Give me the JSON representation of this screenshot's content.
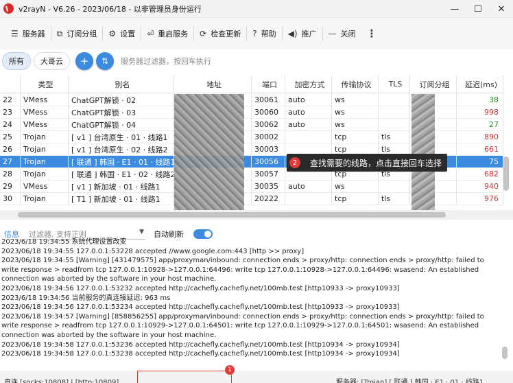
{
  "window": {
    "title": "v2rayN - V6.26 - 2023/06/18 - 以非管理员身份运行",
    "min": "—",
    "max": "☐",
    "close": "✕"
  },
  "menu": [
    {
      "icon": "☰",
      "label": "服务器"
    },
    {
      "icon": "⧉",
      "label": "订阅分组"
    },
    {
      "icon": "⚙",
      "label": "设置"
    },
    {
      "icon": "⏎",
      "label": "重启服务"
    },
    {
      "icon": "⟳",
      "label": "检查更新"
    },
    {
      "icon": "?",
      "label": "帮助"
    },
    {
      "icon": "◀)",
      "label": "推广"
    },
    {
      "icon": "—",
      "label": "关闭"
    },
    {
      "icon": "⋮",
      "label": ""
    }
  ],
  "filters": {
    "chips": [
      "所有",
      "大哥云"
    ],
    "add": "+",
    "sort": "⇅",
    "placeholder": "服务器过滤器，按回车执行"
  },
  "grid": {
    "headers": [
      "",
      "类型",
      "别名",
      "地址",
      "端口",
      "加密方式",
      "传输协议",
      "TLS",
      "订阅分组",
      "延迟(ms)"
    ],
    "rows": [
      {
        "id": "22",
        "type": "VMess",
        "alias": "ChatGPT解锁 · 02",
        "port": "30061",
        "enc": "auto",
        "net": "ws",
        "tls": "",
        "delay": "38",
        "color": "green"
      },
      {
        "id": "23",
        "type": "VMess",
        "alias": "ChatGPT解锁 · 03",
        "port": "30060",
        "enc": "auto",
        "net": "ws",
        "tls": "",
        "delay": "998",
        "color": "red"
      },
      {
        "id": "24",
        "type": "VMess",
        "alias": "ChatGPT解锁 · 04",
        "port": "30062",
        "enc": "auto",
        "net": "ws",
        "tls": "",
        "delay": "27",
        "color": "green"
      },
      {
        "id": "25",
        "type": "Trojan",
        "alias": "[ v1 ] 台湾原生 · 01 · 线路1",
        "port": "30002",
        "enc": "",
        "net": "tcp",
        "tls": "tls",
        "delay": "890",
        "color": "red"
      },
      {
        "id": "26",
        "type": "Trojan",
        "alias": "[ v1 ] 台湾原生 · 02 · 线路2",
        "port": "30003",
        "enc": "",
        "net": "tcp",
        "tls": "tls",
        "delay": "661",
        "color": "red"
      },
      {
        "id": "27",
        "type": "Trojan",
        "alias": "[ 联通 ] 韩国 · E1 · 01 · 线路1",
        "port": "30056",
        "enc": "",
        "net": "tcp",
        "tls": "tls",
        "delay": "75",
        "color": "green"
      },
      {
        "id": "28",
        "type": "Trojan",
        "alias": "[ 联通 ] 韩国 · E1 · 02 · 线路2",
        "port": "30057",
        "enc": "",
        "net": "tcp",
        "tls": "tls",
        "delay": "682",
        "color": "red"
      },
      {
        "id": "29",
        "type": "VMess",
        "alias": "[ v1 ] 新加坡 · 01 · 线路1",
        "port": "30035",
        "enc": "auto",
        "net": "ws",
        "tls": "",
        "delay": "940",
        "color": "red"
      },
      {
        "id": "30",
        "type": "Trojan",
        "alias": "[ T1 ] 新加坡 · 01 · 线路1",
        "port": "20222",
        "enc": "",
        "net": "tcp",
        "tls": "tls",
        "delay": "976",
        "color": "red"
      }
    ]
  },
  "tooltip": {
    "badge": "2",
    "text": "查找需要的线路，点击直接回车选择"
  },
  "logbar": {
    "tab": "信息",
    "filter_placeholder": "过滤器, 支持正则",
    "auto_label": "自动刷新"
  },
  "log": [
    "2023/6/18 19:34:55 系统代理设置改变",
    "2023/06/18 19:34:55 127.0.0.1:53228 accepted //www.google.com:443 [http >> proxy]",
    "2023/06/18 19:34:55 [Warning] [431479575] app/proxyman/inbound: connection ends > proxy/http: connection ends > proxy/http: failed to write response > readfrom tcp 127.0.0.1:10928->127.0.0.1:64496: write tcp 127.0.0.1:10928->127.0.0.1:64496: wsasend: An established connection was aborted by the software in your host machine.",
    "2023/06/18 19:34:56 127.0.0.1:53232 accepted http://cachefly.cachefly.net/100mb.test [http10933 -> proxy10933]",
    "2023/6/18 19:34:56 当前服务的真连接延迟: 963 ms",
    "2023/06/18 19:34:56 127.0.0.1:53234 accepted http://cachefly.cachefly.net/100mb.test [http10933 -> proxy10933]",
    "2023/06/18 19:34:57 [Warning] [858856255] app/proxyman/inbound: connection ends > proxy/http: connection ends > proxy/http: failed to write response > readfrom tcp 127.0.0.1:10929->127.0.0.1:64501: write tcp 127.0.0.1:10929->127.0.0.1:64501: wsasend: An established connection was aborted by the software in your host machine.",
    "2023/06/18 19:34:58 127.0.0.1:53236 accepted http://cachefly.cachefly.net/100mb.test [http10934 -> proxy10934]",
    "2023/06/18 19:34:58 127.0.0.1:53238 accepted http://cachefly.cachefly.net/100mb.test [http10934 -> proxy10934]"
  ],
  "status": {
    "left": "直连 [socks:10808] | [http:10809]",
    "right": "服务器: [Trojan] [ 联通 ] 韩国 · E1 · 01 · 线路1",
    "badge": "1"
  }
}
